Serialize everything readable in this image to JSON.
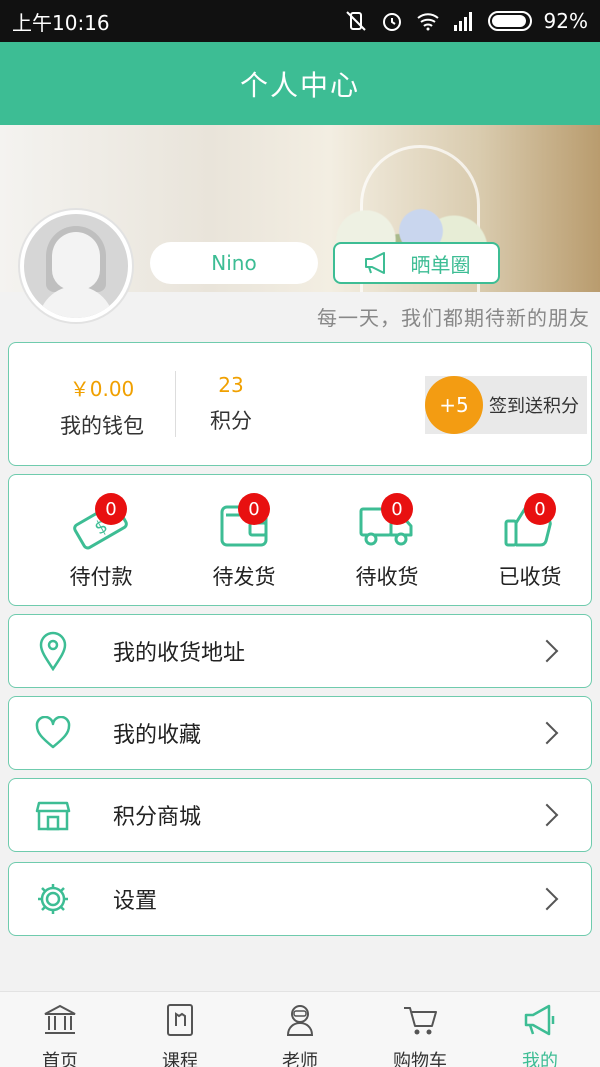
{
  "status_bar": {
    "time": "上午10:16",
    "battery": "92%"
  },
  "header": {
    "title": "个人中心"
  },
  "profile": {
    "name": "Nino",
    "share_label": "晒单圈",
    "slogan": "每一天，我们都期待新的朋友"
  },
  "wallet": {
    "balance": "￥0.00",
    "balance_label": "我的钱包",
    "points": "23",
    "points_label": "积分",
    "signin_bonus": "+5",
    "signin_label": "签到送积分"
  },
  "orders": [
    {
      "label": "待付款",
      "count": "0",
      "icon": "money-icon"
    },
    {
      "label": "待发货",
      "count": "0",
      "icon": "wallet-icon"
    },
    {
      "label": "待收货",
      "count": "0",
      "icon": "truck-icon"
    },
    {
      "label": "已收货",
      "count": "0",
      "icon": "thumbs-up-icon"
    }
  ],
  "menu": [
    {
      "label": "我的收货地址",
      "icon": "location-icon"
    },
    {
      "label": "我的收藏",
      "icon": "heart-icon"
    },
    {
      "label": "积分商城",
      "icon": "store-icon"
    },
    {
      "label": "设置",
      "icon": "gear-icon"
    }
  ],
  "nav": [
    {
      "label": "首页",
      "icon": "bank-icon"
    },
    {
      "label": "课程",
      "icon": "book-icon"
    },
    {
      "label": "老师",
      "icon": "teacher-icon"
    },
    {
      "label": "购物车",
      "icon": "cart-icon"
    },
    {
      "label": "我的",
      "icon": "megaphone-icon",
      "active": true
    }
  ],
  "colors": {
    "primary": "#3dbd94",
    "accent": "#f39c12",
    "badge": "#e81010"
  }
}
